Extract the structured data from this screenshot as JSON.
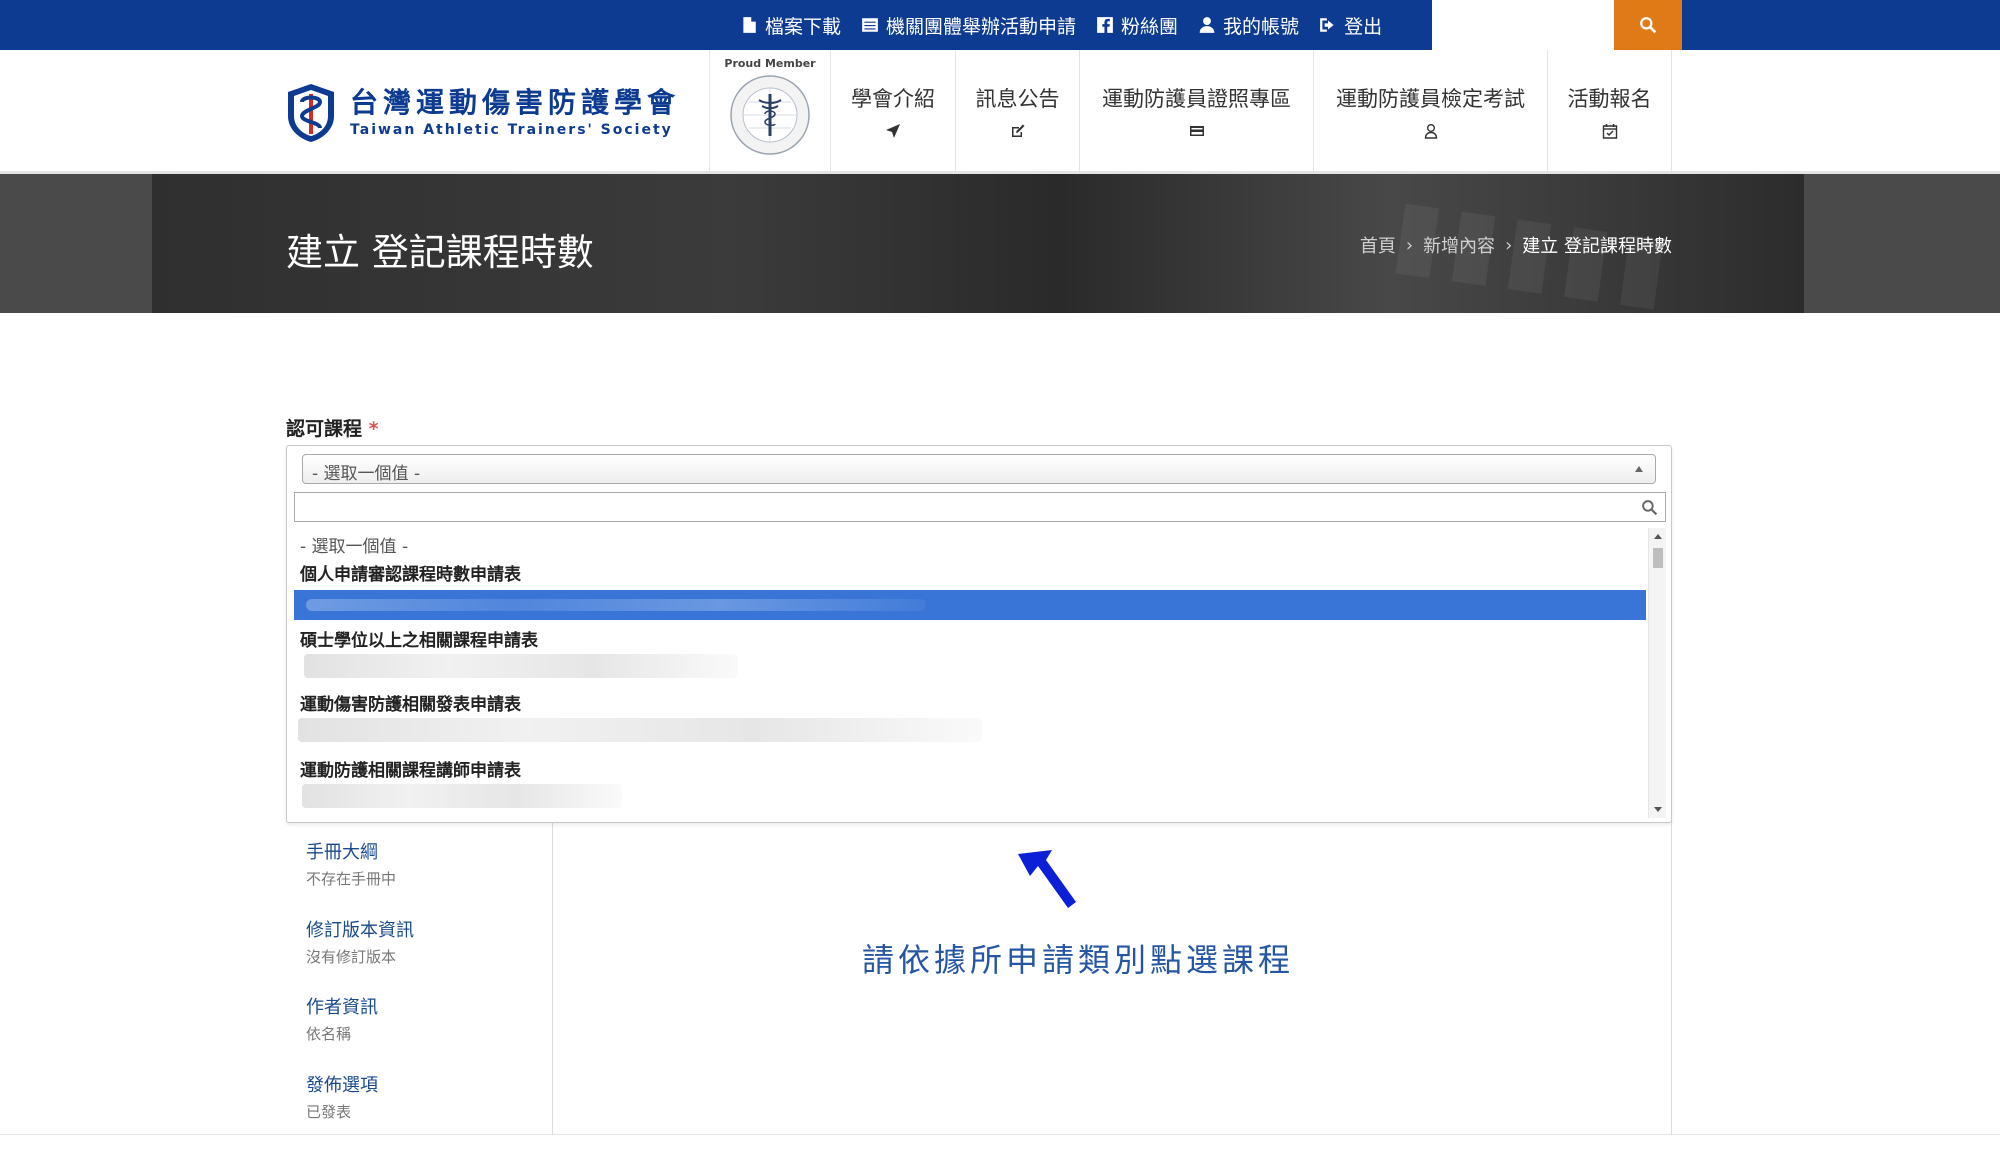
{
  "topbar": {
    "links": [
      {
        "icon": "file-icon",
        "label": "檔案下載"
      },
      {
        "icon": "list-icon",
        "label": "機關團體舉辦活動申請"
      },
      {
        "icon": "facebook-icon",
        "label": "粉絲團"
      },
      {
        "icon": "user-icon",
        "label": "我的帳號"
      },
      {
        "icon": "sign-out-icon",
        "label": "登出"
      }
    ],
    "search_value": "",
    "colors": {
      "bar": "#0d3b92",
      "search_button": "#e07a17"
    }
  },
  "logo": {
    "name_cn": "台灣運動傷害防護學會",
    "name_en": "Taiwan Athletic Trainers' Society"
  },
  "member_badge": {
    "label": "Proud Member"
  },
  "nav": [
    {
      "label": "學會介紹",
      "icon": "location-arrow-icon"
    },
    {
      "label": "訊息公告",
      "icon": "edit-icon"
    },
    {
      "label": "運動防護員證照專區",
      "icon": "credit-card-icon"
    },
    {
      "label": "運動防護員檢定考試",
      "icon": "user-outline-icon"
    },
    {
      "label": "活動報名",
      "icon": "calendar-check-icon"
    }
  ],
  "banner": {
    "title": "建立 登記課程時數",
    "breadcrumb": [
      "首頁",
      "新增內容",
      "建立 登記課程時數"
    ]
  },
  "form": {
    "field_label": "認可課程",
    "required_mark": "*",
    "select_value": "- 選取一個值 -",
    "dropdown": {
      "search_value": "",
      "placeholder_option": "- 選取一個值 -",
      "groups": [
        "個人申請審認課程時數申請表",
        "碩士學位以上之相關課程申請表",
        "運動傷害防護相關發表申請表",
        "運動防護相關課程講師申請表"
      ]
    }
  },
  "sidebar_tabs": [
    {
      "title": "手冊大綱",
      "summary": "不存在手冊中"
    },
    {
      "title": "修訂版本資訊",
      "summary": "沒有修訂版本"
    },
    {
      "title": "作者資訊",
      "summary": "依名稱"
    },
    {
      "title": "發佈選項",
      "summary": "已發表"
    }
  ],
  "annotation": {
    "text": "請依據所申請類別點選課程",
    "color": "#2456a4"
  }
}
